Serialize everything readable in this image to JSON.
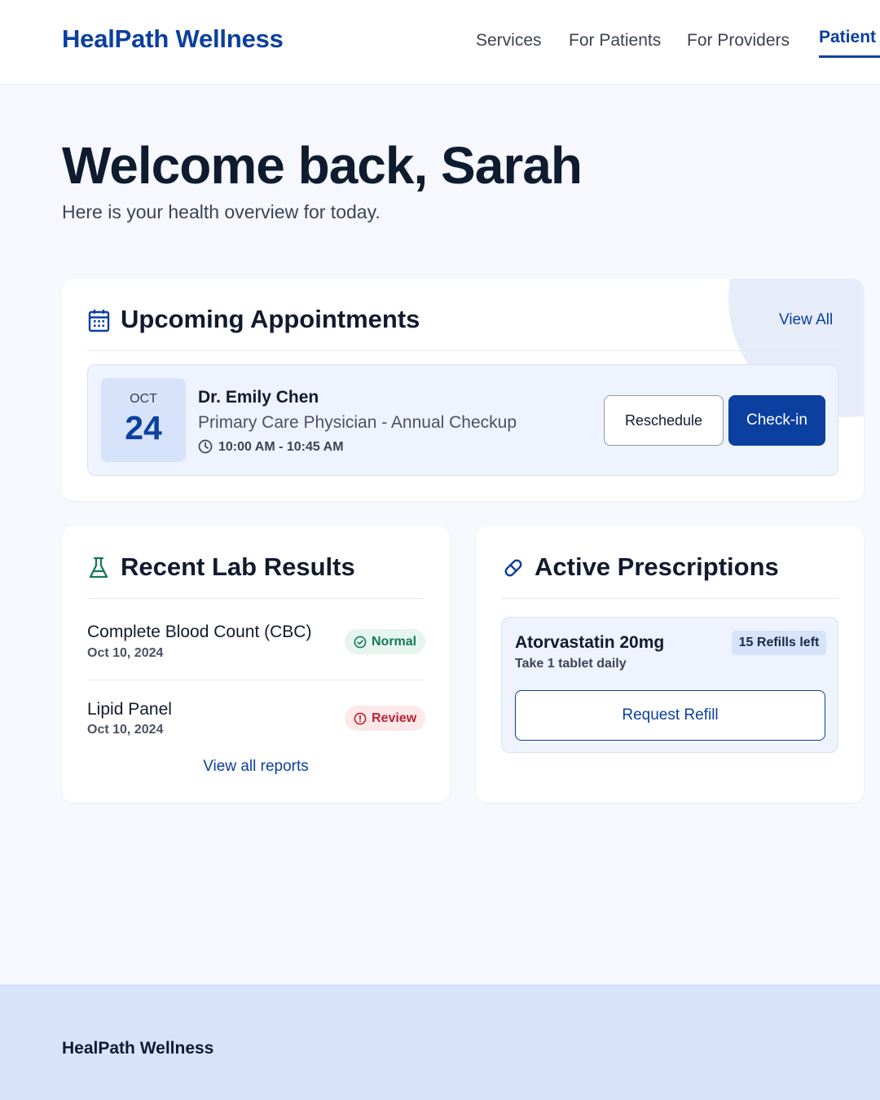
{
  "header": {
    "logo": "HealPath Wellness",
    "nav": [
      {
        "label": "Services"
      },
      {
        "label": "For Patients"
      },
      {
        "label": "For Providers"
      },
      {
        "label": "Patient",
        "active": true
      }
    ]
  },
  "hero": {
    "title": "Welcome back, Sarah",
    "subtitle": "Here is your health overview for today."
  },
  "appointments": {
    "icon": "calendar-icon",
    "title": "Upcoming Appointments",
    "view_all": "View All",
    "items": [
      {
        "month": "OCT",
        "day": "24",
        "doctor": "Dr. Emily Chen",
        "specialty": "Primary Care Physician - Annual Checkup",
        "time": "10:00 AM - 10:45 AM",
        "reschedule_label": "Reschedule",
        "checkin_label": "Check-in"
      }
    ]
  },
  "labs": {
    "icon": "flask-icon",
    "title": "Recent Lab Results",
    "items": [
      {
        "name": "Complete Blood Count (CBC)",
        "date": "Oct 10, 2024",
        "status": "Normal",
        "status_icon": "check-circle-icon"
      },
      {
        "name": "Lipid Panel",
        "date": "Oct 10, 2024",
        "status": "Review",
        "status_icon": "alert-circle-icon"
      }
    ],
    "view_reports": "View all reports"
  },
  "prescriptions": {
    "icon": "pill-icon",
    "title": "Active Prescriptions",
    "items": [
      {
        "name": "Atorvastatin 20mg",
        "dosage": "Take 1 tablet daily",
        "refills": "15 Refills left",
        "refill_button": "Request Refill"
      }
    ]
  },
  "footer": {
    "brand": "HealPath Wellness"
  },
  "colors": {
    "brand": "#0b3fa0",
    "background": "#f6f8fd",
    "normal": "#15795a",
    "review": "#c0212f",
    "footer_bg": "#d6e3fb"
  }
}
